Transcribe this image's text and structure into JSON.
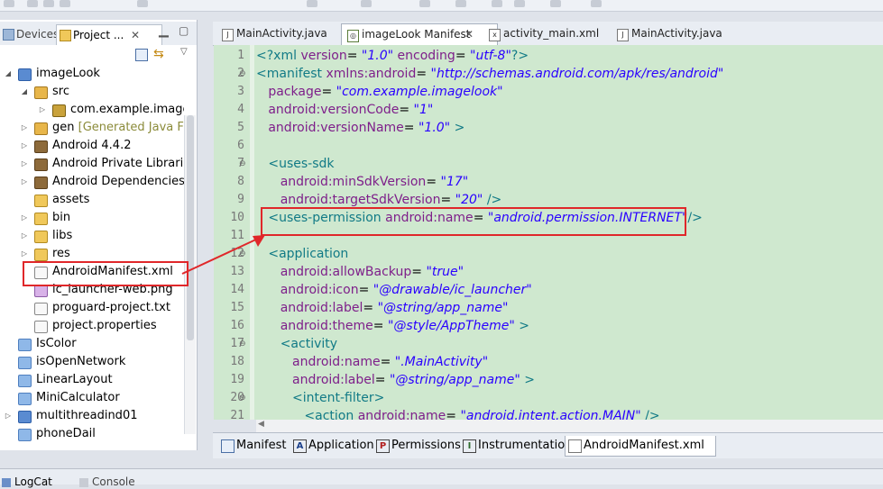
{
  "left_panel": {
    "tabs": [
      {
        "label": "Devices",
        "active": false
      },
      {
        "label": "Project ...",
        "active": true
      }
    ],
    "tree": [
      {
        "label": "imageLook",
        "icon": "android-project-icon"
      },
      {
        "label": "src",
        "icon": "source-folder-icon"
      },
      {
        "label": "com.example.imagelc",
        "icon": "package-icon"
      },
      {
        "label": "gen",
        "suffix": "[Generated Java File",
        "icon": "source-folder-icon"
      },
      {
        "label": "Android 4.4.2",
        "icon": "library-icon"
      },
      {
        "label": "Android Private Libraries",
        "icon": "library-icon"
      },
      {
        "label": "Android Dependencies",
        "icon": "library-icon"
      },
      {
        "label": "assets",
        "icon": "folder-icon"
      },
      {
        "label": "bin",
        "icon": "folder-icon"
      },
      {
        "label": "libs",
        "icon": "folder-icon"
      },
      {
        "label": "res",
        "icon": "folder-icon"
      },
      {
        "label": "AndroidManifest.xml",
        "icon": "xml-file-icon"
      },
      {
        "label": "ic_launcher-web.png",
        "icon": "image-file-icon"
      },
      {
        "label": "proguard-project.txt",
        "icon": "text-file-icon"
      },
      {
        "label": "project.properties",
        "icon": "text-file-icon"
      },
      {
        "label": "IsColor",
        "icon": "project-icon"
      },
      {
        "label": "isOpenNetwork",
        "icon": "project-icon"
      },
      {
        "label": "LinearLayout",
        "icon": "project-icon"
      },
      {
        "label": "MiniCalculator",
        "icon": "project-icon"
      },
      {
        "label": "multithreadind01",
        "icon": "project-icon"
      },
      {
        "label": "phoneDail",
        "icon": "project-icon"
      }
    ]
  },
  "editor": {
    "tabs": [
      {
        "label": "MainActivity.java",
        "active": false,
        "icon": "java-file-icon"
      },
      {
        "label": "imageLook Manifest",
        "active": true,
        "icon": "manifest-icon"
      },
      {
        "label": "activity_main.xml",
        "active": false,
        "icon": "xml-file-icon"
      },
      {
        "label": "MainActivity.java",
        "active": false,
        "icon": "java-file-icon"
      }
    ],
    "line_numbers": [
      "1",
      "2",
      "3",
      "4",
      "5",
      "6",
      "7",
      "8",
      "9",
      "10",
      "11",
      "12",
      "13",
      "14",
      "15",
      "16",
      "17",
      "18",
      "19",
      "20",
      "21"
    ],
    "lines": [
      [
        [
          "tag",
          "<?xml "
        ],
        [
          "attr",
          "version"
        ],
        [
          "eq",
          "= "
        ],
        [
          "val",
          "\"1.0\""
        ],
        [
          "attr",
          " encoding"
        ],
        [
          "eq",
          "= "
        ],
        [
          "val",
          "\"utf-8\""
        ],
        [
          "tag",
          "?>"
        ]
      ],
      [
        [
          "tag",
          "<manifest "
        ],
        [
          "attr",
          "xmlns:android"
        ],
        [
          "eq",
          "= "
        ],
        [
          "val",
          "\"http://schemas.android.com/apk/res/android\""
        ]
      ],
      [
        [
          "attr",
          "   package"
        ],
        [
          "eq",
          "= "
        ],
        [
          "val",
          "\"com.example.imagelook\""
        ]
      ],
      [
        [
          "attr",
          "   android:versionCode"
        ],
        [
          "eq",
          "= "
        ],
        [
          "val",
          "\"1\""
        ]
      ],
      [
        [
          "attr",
          "   android:versionName"
        ],
        [
          "eq",
          "= "
        ],
        [
          "val",
          "\"1.0\""
        ],
        [
          "tag",
          " >"
        ]
      ],
      [],
      [
        [
          "tag",
          "   <uses-sdk"
        ]
      ],
      [
        [
          "attr",
          "      android:minSdkVersion"
        ],
        [
          "eq",
          "= "
        ],
        [
          "val",
          "\"17\""
        ]
      ],
      [
        [
          "attr",
          "      android:targetSdkVersion"
        ],
        [
          "eq",
          "= "
        ],
        [
          "val",
          "\"20\""
        ],
        [
          "tag",
          " />"
        ]
      ],
      [
        [
          "tag",
          "   <uses-permission "
        ],
        [
          "attr",
          "android:name"
        ],
        [
          "eq",
          "= "
        ],
        [
          "val",
          "\"android.permission.INTERNET\""
        ],
        [
          "tag",
          "/>"
        ]
      ],
      [],
      [
        [
          "tag",
          "   <application"
        ]
      ],
      [
        [
          "attr",
          "      android:allowBackup"
        ],
        [
          "eq",
          "= "
        ],
        [
          "val",
          "\"true\""
        ]
      ],
      [
        [
          "attr",
          "      android:icon"
        ],
        [
          "eq",
          "= "
        ],
        [
          "val",
          "\"@drawable/ic_launcher\""
        ]
      ],
      [
        [
          "attr",
          "      android:label"
        ],
        [
          "eq",
          "= "
        ],
        [
          "val",
          "\"@string/app_name\""
        ]
      ],
      [
        [
          "attr",
          "      android:theme"
        ],
        [
          "eq",
          "= "
        ],
        [
          "val",
          "\"@style/AppTheme\""
        ],
        [
          "tag",
          " >"
        ]
      ],
      [
        [
          "tag",
          "      <activity"
        ]
      ],
      [
        [
          "attr",
          "         android:name"
        ],
        [
          "eq",
          "= "
        ],
        [
          "val",
          "\".MainActivity\""
        ]
      ],
      [
        [
          "attr",
          "         android:label"
        ],
        [
          "eq",
          "= "
        ],
        [
          "val",
          "\"@string/app_name\""
        ],
        [
          "tag",
          " >"
        ]
      ],
      [
        [
          "tag",
          "         <intent-filter>"
        ]
      ],
      [
        [
          "tag",
          "            <action "
        ],
        [
          "attr",
          "android:name"
        ],
        [
          "eq",
          "= "
        ],
        [
          "val",
          "\"android.intent.action.MAIN\""
        ],
        [
          "tag",
          " />"
        ]
      ]
    ],
    "bottom_tabs": [
      {
        "label": "Manifest",
        "icon": "manifest-overview-icon",
        "glyph": "",
        "active": false
      },
      {
        "label": "Application",
        "icon": "application-icon",
        "glyph": "A",
        "active": false
      },
      {
        "label": "Permissions",
        "icon": "permissions-icon",
        "glyph": "P",
        "active": false
      },
      {
        "label": "Instrumentation",
        "icon": "instrumentation-icon",
        "glyph": "I",
        "active": false
      },
      {
        "label": "AndroidManifest.xml",
        "icon": "xml-file-icon",
        "glyph": "",
        "active": true
      }
    ]
  },
  "bottom_panel": {
    "tabs": [
      {
        "label": "LogCat",
        "active": true
      },
      {
        "label": "Console",
        "active": false
      }
    ]
  },
  "colors": {
    "editor_bg": "#cfe8cf",
    "highlight": "#e0272a",
    "xml_tag": "#117a86",
    "xml_attr": "#7e1f8a",
    "xml_value": "#2a00ff"
  }
}
